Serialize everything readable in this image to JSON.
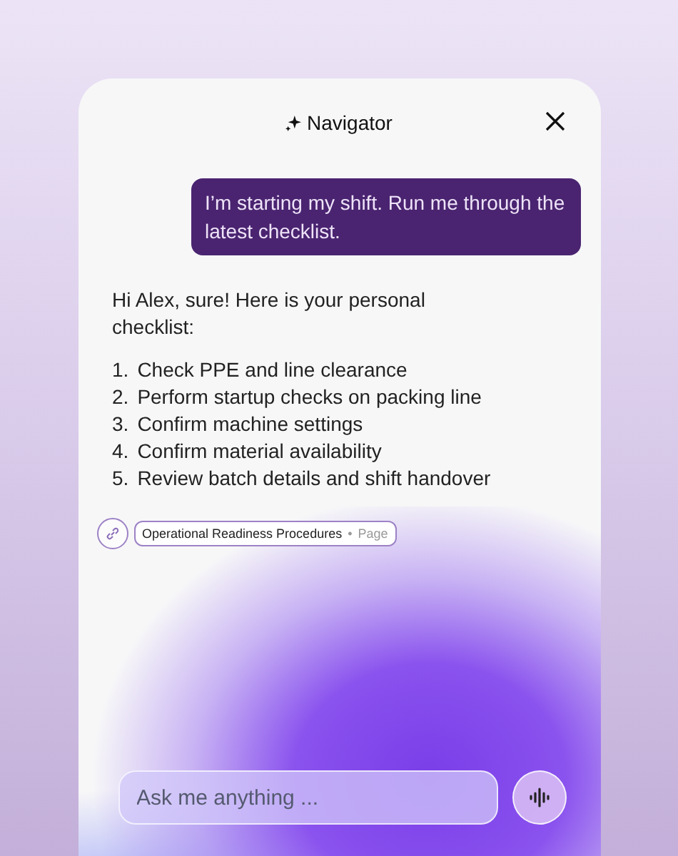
{
  "header": {
    "title": "Navigator"
  },
  "user_message": "I’m starting my shift. Run me through the latest checklist.",
  "reply": {
    "intro": "Hi Alex, sure! Here is your personal checklist:",
    "items": [
      {
        "number": "1.",
        "text": "Check PPE and line clearance"
      },
      {
        "number": "2.",
        "text": "Perform startup checks on packing line"
      },
      {
        "number": "3.",
        "text": "Confirm machine settings"
      },
      {
        "number": "4.",
        "text": "Confirm material availability"
      },
      {
        "number": "5.",
        "text": "Review batch details and shift handover"
      }
    ]
  },
  "source": {
    "title": "Operational Readiness Procedures",
    "separator": "•",
    "type": "Page"
  },
  "input": {
    "placeholder": "Ask me anything ..."
  }
}
